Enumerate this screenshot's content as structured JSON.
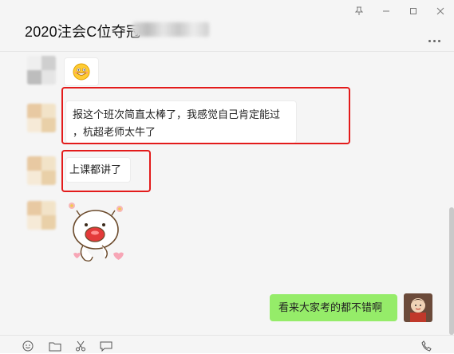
{
  "window": {
    "title": "2020注会C位夺冠",
    "controls": [
      "pin-icon",
      "minimize-icon",
      "maximize-icon",
      "close-icon"
    ]
  },
  "messages": [
    {
      "side": "left",
      "type": "emoji",
      "content": "grinning-face-emoji"
    },
    {
      "side": "left",
      "type": "text",
      "lines": [
        "报这个班次简直太棒了，我感觉自己肯定能过",
        "，杭超老师太牛了"
      ],
      "highlighted": true
    },
    {
      "side": "left",
      "type": "text",
      "lines": [
        "上课都讲了"
      ],
      "highlighted": true
    },
    {
      "side": "left",
      "type": "sticker",
      "content": "cartoon-pig-sticker"
    },
    {
      "side": "right",
      "type": "text",
      "lines": [
        "看来大家考的都不错啊"
      ]
    }
  ],
  "toolbar": {
    "icons": [
      "emoji-icon",
      "folder-icon",
      "scissors-icon",
      "chat-history-icon",
      "voice-call-icon"
    ]
  },
  "colors": {
    "highlight": "#e31b1b",
    "self_bubble": "#95ec69",
    "background": "#f5f5f5"
  }
}
